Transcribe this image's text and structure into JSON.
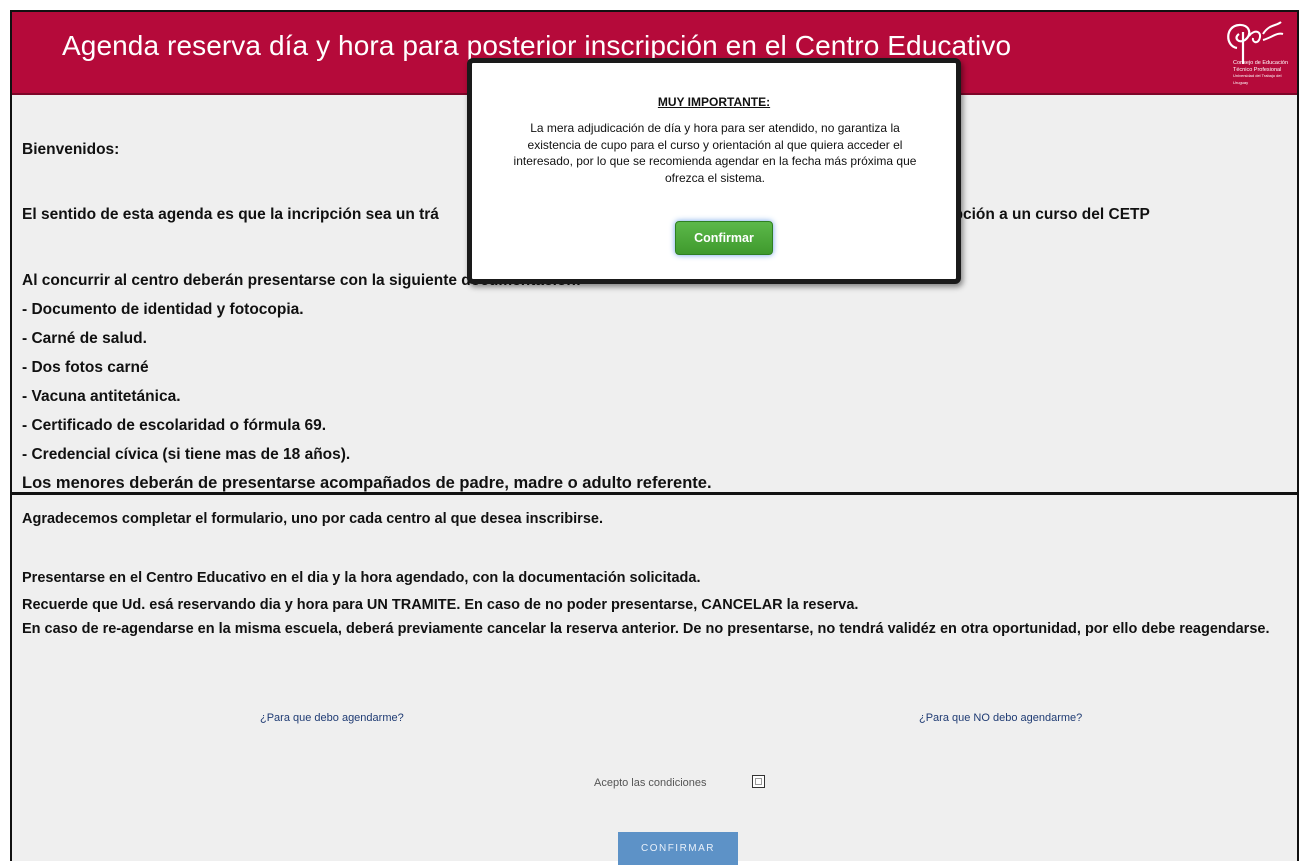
{
  "header": {
    "title": "Agenda reserva día y hora para posterior inscripción en el Centro Educativo",
    "logo_lines": [
      "Consejo de Educación",
      "Técnico Profesional",
      "Universidad del Trabajo del Uruguay"
    ]
  },
  "section1": {
    "welcome": "Bienvenidos:",
    "intro_left": "El sentido de esta agenda es que la incripción sea un trá",
    "intro_right": "scripción a un curso del CETP",
    "documents_lead": "Al concurrir al centro deberán presentarse con la siguiente documentación:",
    "documents": [
      "- Documento de identidad y fotocopia.",
      "- Carné de salud.",
      "- Dos fotos carné",
      "- Vacuna antitetánica.",
      "- Certificado de escolaridad o fórmula 69.",
      "- Credencial cívica (si tiene mas de 18 años)."
    ],
    "minors_note": "Los menores deberán de presentarse acompañados de padre, madre o adulto referente."
  },
  "section2": {
    "thanks": "Agradecemos completar el formulario, uno por cada centro al que desea inscribirse.",
    "present": "Presentarse en el Centro Educativo en el dia y la hora agendado, con la documentación solicitada.",
    "remember": "Recuerde que Ud. esá reservando dia y hora para UN TRAMITE. En caso de no poder presentarse, CANCELAR la reserva.",
    "reschedule": "En caso de re-agendarse en la misma escuela, deberá previamente cancelar la reserva anterior. De no presentarse, no tendrá validéz en otra oportunidad, por ello debe reagendarse.",
    "link_why": "¿Para que debo agendarme?",
    "link_why_not": "¿Para que NO debo agendarme?",
    "accept_label": "Acepto las condiciones",
    "accept_checked": false,
    "confirm_label": "CONFIRMAR"
  },
  "modal": {
    "title": "MUY IMPORTANTE:",
    "body": "La mera adjudicación de día y hora para ser atendido, no garantiza la existencia de cupo para el curso y orientación al que quiera acceder el interesado, por lo que se recomienda agendar en la fecha más próxima que ofrezca el sistema.",
    "confirm_label": "Confirmar"
  },
  "colors": {
    "header_bg": "#b50a3a",
    "page_bg": "#efefef",
    "modal_button": "#4aa838",
    "bottom_button": "#5d92c7"
  }
}
